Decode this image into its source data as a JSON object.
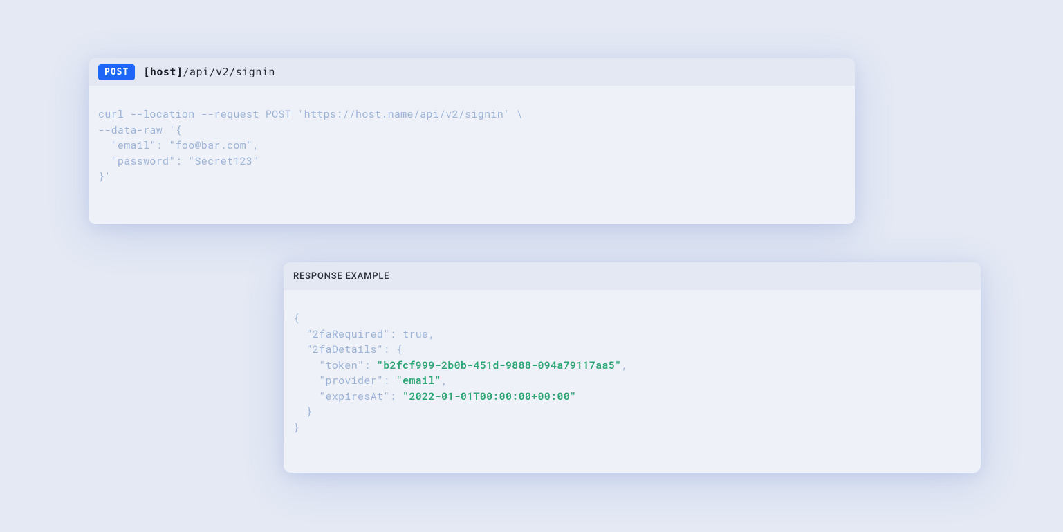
{
  "request": {
    "method": "POST",
    "host_label": "[host]",
    "path": "/api/v2/signin",
    "curl_lines": [
      "curl --location --request POST 'https://host.name/api/v2/signin' \\",
      "--data-raw '{",
      "  \"email\": \"foo@bar.com\",",
      "  \"password\": \"Secret123\"",
      "}'"
    ]
  },
  "response": {
    "title": "RESPONSE EXAMPLE",
    "json": {
      "open": "{",
      "l1_key": "\"2faRequired\"",
      "l1_colon": ": ",
      "l1_val": "true",
      "l1_comma": ",",
      "l2_key": "\"2faDetails\"",
      "l2_colon": ": {",
      "l3_key": "\"token\"",
      "l3_colon": ": ",
      "l3_val": "\"b2fcf999-2b0b-451d-9888-094a79117aa5\"",
      "l3_comma": ",",
      "l4_key": "\"provider\"",
      "l4_colon": ": ",
      "l4_val": "\"email\"",
      "l4_comma": ",",
      "l5_key": "\"expiresAt\"",
      "l5_colon": ": ",
      "l5_val": "\"2022-01-01T00:00:00+00:00\"",
      "l6": "  }",
      "close": "}"
    }
  }
}
